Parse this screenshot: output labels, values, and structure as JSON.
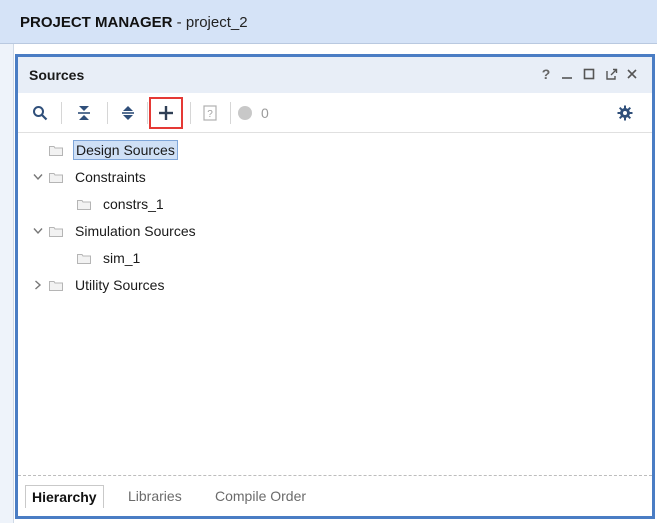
{
  "header": {
    "title_main": "PROJECT MANAGER",
    "title_sep": " - ",
    "project_name": "project_2"
  },
  "panel": {
    "title": "Sources",
    "controls": {
      "help_label": "?",
      "minimize_icon": "minimize-icon",
      "maximize_icon": "maximize-icon",
      "float_icon": "float-icon",
      "close_icon": "close-icon"
    }
  },
  "toolbar": {
    "count": "0"
  },
  "tree": {
    "items": [
      {
        "label": "Design Sources",
        "expanded": null,
        "selected": true
      },
      {
        "label": "Constraints",
        "expanded": true
      },
      {
        "label": "constrs_1"
      },
      {
        "label": "Simulation Sources",
        "expanded": true
      },
      {
        "label": "sim_1"
      },
      {
        "label": "Utility Sources",
        "expanded": false
      }
    ]
  },
  "tabs": [
    {
      "label": "Hierarchy",
      "active": true
    },
    {
      "label": "Libraries",
      "active": false
    },
    {
      "label": "Compile Order",
      "active": false
    }
  ],
  "colors": {
    "accent_border": "#4a7dc4",
    "header_bg": "#d5e3f7",
    "highlight_red": "#e53935"
  }
}
